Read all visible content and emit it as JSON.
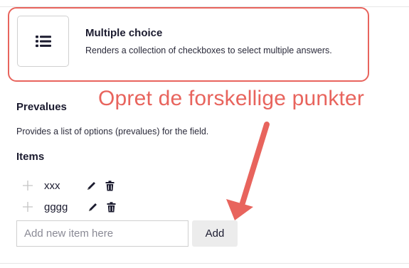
{
  "field_type": {
    "title": "Multiple choice",
    "description": "Renders a collection of checkboxes to select multiple answers.",
    "icon": "list-icon"
  },
  "annotation": {
    "text": "Opret de forskellige punkter",
    "color": "#e8645d"
  },
  "prevalues": {
    "heading": "Prevalues",
    "description": "Provides a list of options (prevalues) for the field."
  },
  "items": {
    "heading": "Items",
    "list": [
      {
        "label": "xxx"
      },
      {
        "label": "gggg"
      }
    ],
    "new_item": {
      "value": "",
      "placeholder": "Add new item here"
    },
    "add_label": "Add"
  },
  "colors": {
    "accent": "#e8645d",
    "text": "#1b1b2f"
  }
}
